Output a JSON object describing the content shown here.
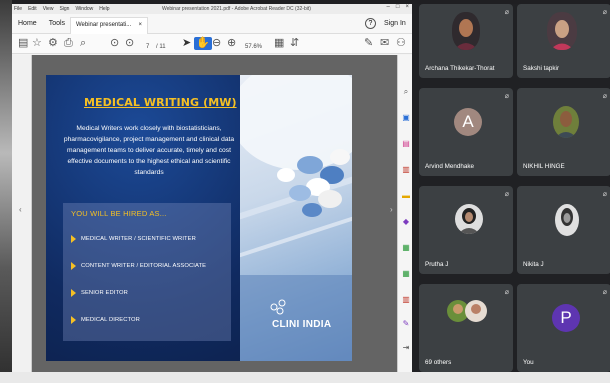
{
  "acrobat": {
    "window_title": "Webinar presentation 2021.pdf - Adobe Acrobat Reader DC (32-bit)",
    "menu": [
      "File",
      "Edit",
      "View",
      "Sign",
      "Window",
      "Help"
    ],
    "nav_home": "Home",
    "nav_tools": "Tools",
    "doc_tab_label": "Webinar presentati...",
    "doc_tab_close": "×",
    "help_glyph": "?",
    "sign_in": "Sign In",
    "page_current": "7",
    "page_total": "/ 11",
    "zoom": "57.6%"
  },
  "slide": {
    "title": "MEDICAL WRITING (MW)",
    "body": "Medical Writers work closely with biostatisticians, pharmacovigilance, project management and clinical data management teams to deliver accurate, timely and cost effective documents to the highest ethical and scientific standards",
    "hired_title": "YOU WILL BE HIRED AS...",
    "roles": [
      "MEDICAL WRITER / SCIENTIFIC WRITER",
      "CONTENT WRITER / EDITORIAL ASSOCIATE",
      "SENIOR EDITOR",
      "MEDICAL DIRECTOR"
    ],
    "logo_text": "CLINI INDIA",
    "colors": {
      "title": "#f5c024",
      "background": "#102a60"
    }
  },
  "participants": [
    {
      "name": "Archana Thikekar-Thorat",
      "avatar": "photo"
    },
    {
      "name": "Sakshi tapkir",
      "avatar": "photo"
    },
    {
      "name": "Arvind Mendhake",
      "avatar": "letter",
      "letter": "A",
      "color": "#a1887f"
    },
    {
      "name": "NIKHIL HINGE",
      "avatar": "photo"
    },
    {
      "name": "Prutha J",
      "avatar": "photo"
    },
    {
      "name": "Nikita J",
      "avatar": "photo"
    },
    {
      "name": "69 others",
      "avatar": "group"
    },
    {
      "name": "You",
      "avatar": "letter",
      "letter": "P",
      "color": "#5e35b1"
    }
  ]
}
